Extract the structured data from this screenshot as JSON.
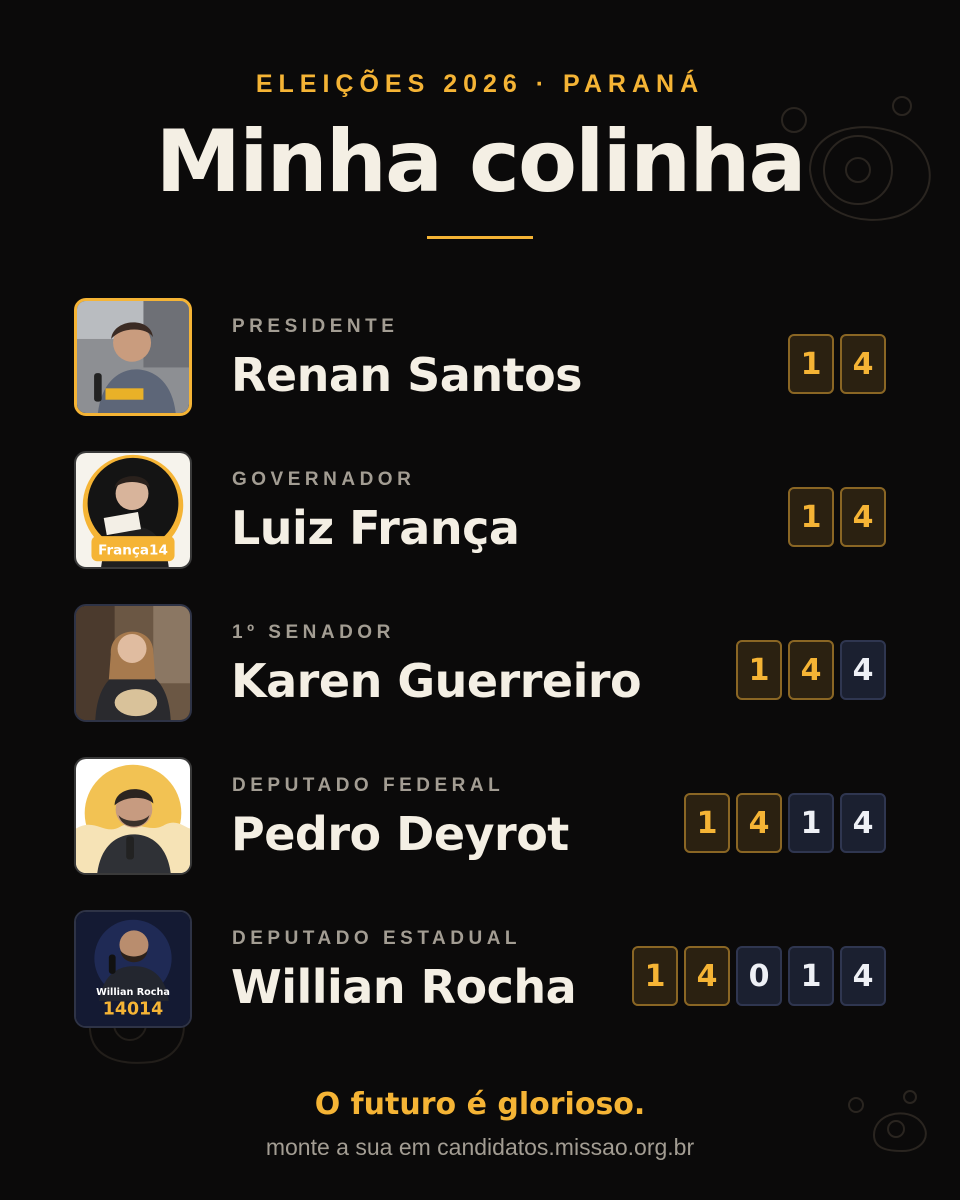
{
  "header": {
    "eyebrow": "ELEIÇÕES 2026 · PARANÁ",
    "title": "Minha colinha"
  },
  "candidates": [
    {
      "role": "PRESIDENTE",
      "name": "Renan Santos",
      "party_digits": [
        "1",
        "4"
      ],
      "candidate_digits": [],
      "photo": "renan-santos-photo"
    },
    {
      "role": "GOVERNADOR",
      "name": "Luiz França",
      "party_digits": [
        "1",
        "4"
      ],
      "candidate_digits": [],
      "photo": "luiz-franca-photo",
      "photo_text": "França14"
    },
    {
      "role": "1º SENADOR",
      "name": "Karen Guerreiro",
      "party_digits": [
        "1",
        "4"
      ],
      "candidate_digits": [
        "4"
      ],
      "photo": "karen-guerreiro-photo"
    },
    {
      "role": "DEPUTADO FEDERAL",
      "name": "Pedro Deyrot",
      "party_digits": [
        "1",
        "4"
      ],
      "candidate_digits": [
        "1",
        "4"
      ],
      "photo": "pedro-deyrot-photo"
    },
    {
      "role": "DEPUTADO ESTADUAL",
      "name": "Willian Rocha",
      "party_digits": [
        "1",
        "4"
      ],
      "candidate_digits": [
        "0",
        "1",
        "4"
      ],
      "photo": "willian-rocha-photo",
      "photo_text": "Willian Rocha",
      "photo_number": "14014"
    }
  ],
  "footer": {
    "tagline": "O futuro é glorioso.",
    "site": "monte a sua em candidatos.missao.org.br"
  },
  "colors": {
    "background": "#0b0a0a",
    "accent": "#f5b435",
    "text": "#f4efe4",
    "muted": "#a39d93",
    "party_box": "#2b2111",
    "candidate_box": "#1b2030"
  }
}
